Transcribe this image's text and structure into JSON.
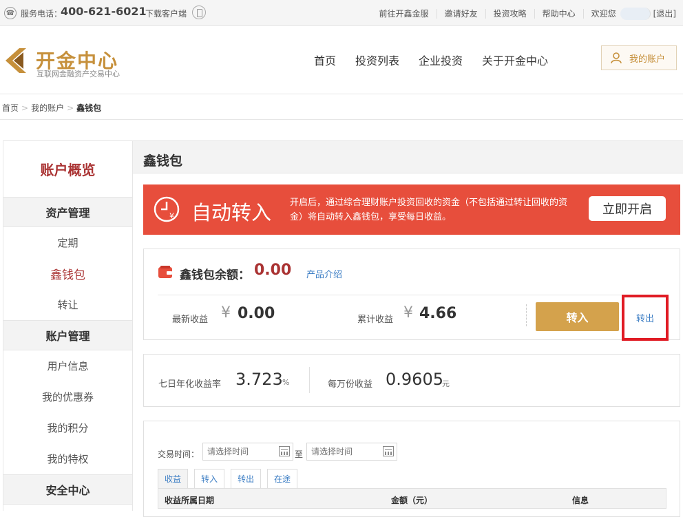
{
  "topbar": {
    "service_label": "服务电话：",
    "service_phone": "400-621-6021",
    "download_label": "下载客户端",
    "links": [
      "前往开鑫金服",
      "邀请好友",
      "投资攻略",
      "帮助中心"
    ],
    "welcome": "欢迎您",
    "logout": "[退出]"
  },
  "header": {
    "logo_title": "开金中心",
    "logo_subtitle": "互联网金融资产交易中心",
    "nav": [
      "首页",
      "投资列表",
      "企业投资",
      "关于开金中心"
    ],
    "account_label": "我的账户"
  },
  "breadcrumb": {
    "items": [
      "首页",
      "我的账户",
      "鑫钱包"
    ],
    "separator": ">"
  },
  "sidebar": {
    "title": "账户概览",
    "groups": [
      {
        "label": "资产管理",
        "items": [
          "定期",
          "鑫钱包",
          "转让"
        ]
      },
      {
        "label": "账户管理",
        "items": [
          "用户信息",
          "我的优惠券",
          "我的积分",
          "我的特权"
        ]
      },
      {
        "label": "安全中心",
        "items": []
      }
    ],
    "active_item": "鑫钱包"
  },
  "main": {
    "title": "鑫钱包",
    "banner": {
      "title": "自动转入",
      "description": "开启后，通过综合理财账户投资回收的资金（不包括通过转让回收的资金）将自动转入鑫钱包，享受每日收益。",
      "button": "立即开启"
    },
    "balance": {
      "label": "鑫钱包余额：",
      "value": "0.00",
      "intro_link": "产品介绍",
      "latest_label": "最新收益",
      "latest_value": "0.00",
      "cumulative_label": "累计收益",
      "cumulative_value": "4.66",
      "currency": "¥",
      "in_button": "转入",
      "out_link": "转出"
    },
    "rates": {
      "seven_day_label": "七日年化收益率",
      "seven_day_value": "3.723",
      "seven_day_unit": "%",
      "per_10k_label": "每万份收益",
      "per_10k_value": "0.9605",
      "per_10k_unit": "元"
    },
    "transactions": {
      "time_label": "交易时间：",
      "date_placeholder": "请选择时间",
      "to_label": "至",
      "tabs": [
        "收益",
        "转入",
        "转出",
        "在途"
      ],
      "columns": [
        "收益所属日期",
        "金额（元）",
        "信息"
      ]
    }
  },
  "colors": {
    "brand_gold": "#c6903b",
    "banner_red": "#e74e3c",
    "accent_red": "#a33",
    "link_blue": "#3b7dc4",
    "button_gold": "#d4a24c",
    "highlight_box": "#e01b24"
  }
}
